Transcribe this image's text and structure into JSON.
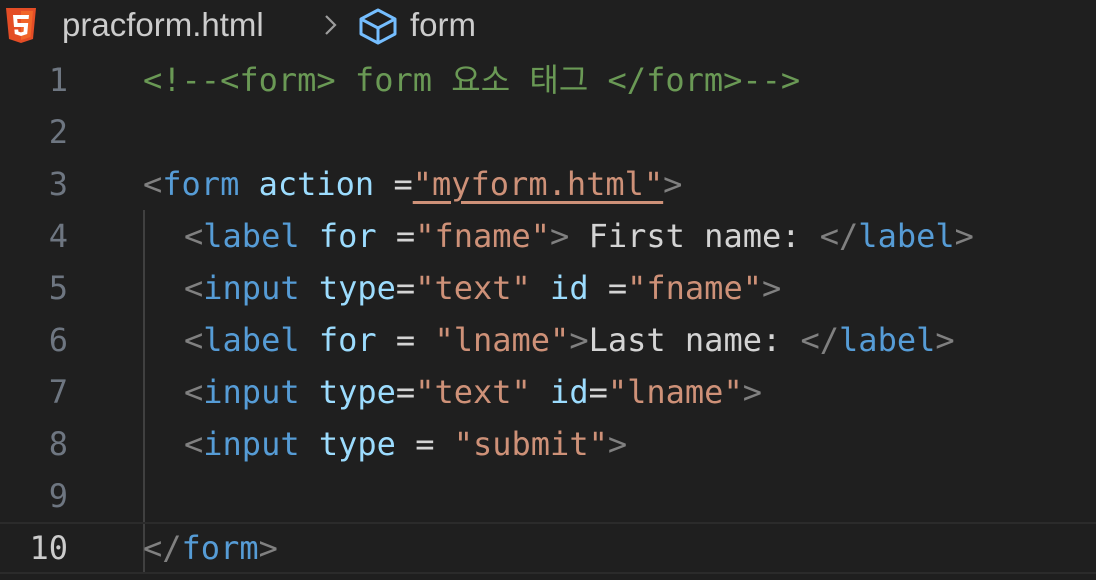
{
  "breadcrumb": {
    "file": "pracform.html",
    "symbol": "form"
  },
  "editor": {
    "active_line": "10",
    "lines": [
      {
        "number": "1"
      },
      {
        "number": "2"
      },
      {
        "number": "3"
      },
      {
        "number": "4"
      },
      {
        "number": "5"
      },
      {
        "number": "6"
      },
      {
        "number": "7"
      },
      {
        "number": "8"
      },
      {
        "number": "9"
      },
      {
        "number": "10"
      }
    ],
    "tokens": {
      "l1_comment": "<!--<form> form 요소 태그 </form>-->",
      "lt": "<",
      "gt": ">",
      "close_open": "</",
      "form": "form",
      "label": "label",
      "input": "input",
      "action": "action",
      "for": "for",
      "type": "type",
      "id": "id",
      "l3_eq": " =",
      "l3_val": "\"myform.html\"",
      "l4_eq": " =",
      "l4_val": "\"fname\"",
      "l4_text": " First name: ",
      "l5_eq": "=",
      "l5_val1": "\"text\"",
      "l5_eq2": " =",
      "l5_val2": "\"fname\"",
      "l6_eq": " = ",
      "l6_val": "\"lname\"",
      "l6_text": "Last name: ",
      "l7_eq": "=",
      "l7_val1": "\"text\"",
      "l7_eq2": "=",
      "l7_val2": "\"lname\"",
      "l8_eq": " = ",
      "l8_val": "\"submit\""
    }
  },
  "colors": {
    "background": "#1f1f1f",
    "comment": "#6a9955",
    "tag": "#569cd6",
    "attribute": "#9cdcfe",
    "string": "#ce9178",
    "bracket": "#808080",
    "html5_icon": "#e44d26",
    "cube_icon": "#75beff"
  },
  "icons": {
    "file_icon": "html5-icon",
    "separator_icon": "chevron-right-icon",
    "symbol_icon": "cube-icon"
  }
}
